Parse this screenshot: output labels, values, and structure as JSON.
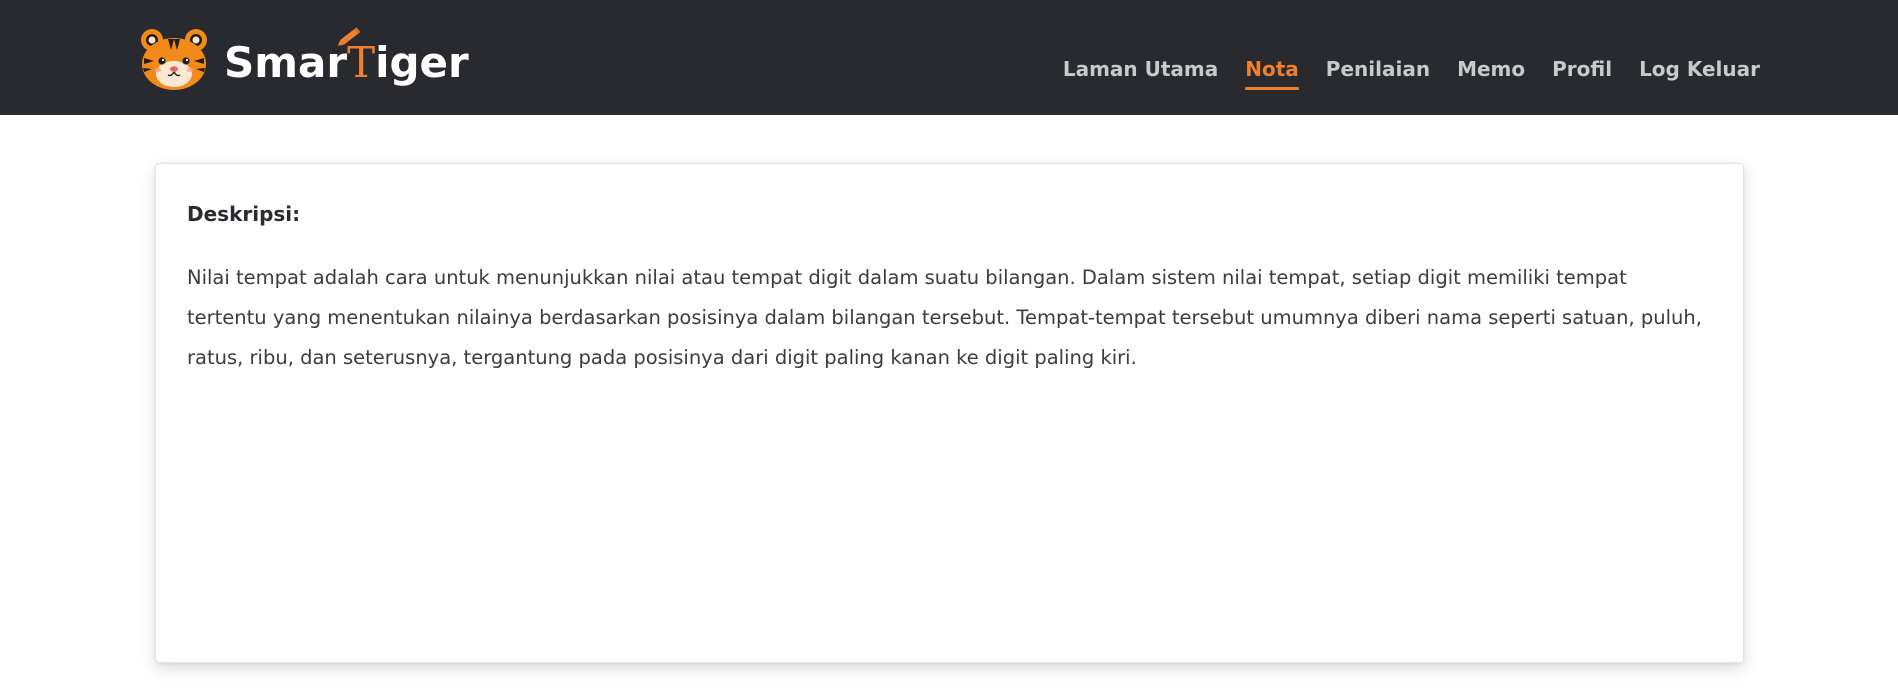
{
  "brand": {
    "name_part1": "Smar",
    "name_accent": "T",
    "name_part2": "iger",
    "logo_icon": "tiger-icon",
    "pencil_icon": "pencil-icon",
    "accent_color": "#f07f2d"
  },
  "nav": {
    "items": [
      {
        "label": "Laman Utama",
        "active": false
      },
      {
        "label": "Nota",
        "active": true
      },
      {
        "label": "Penilaian",
        "active": false
      },
      {
        "label": "Memo",
        "active": false
      },
      {
        "label": "Profil",
        "active": false
      },
      {
        "label": "Log Keluar",
        "active": false
      }
    ]
  },
  "content": {
    "label": "Deskripsi:",
    "text": "Nilai tempat adalah cara untuk menunjukkan nilai atau tempat digit dalam suatu bilangan. Dalam sistem nilai tempat, setiap digit memiliki tempat tertentu yang menentukan nilainya berdasarkan posisinya dalam bilangan tersebut. Tempat-tempat tersebut umumnya diberi nama seperti satuan, puluh, ratus, ribu, dan seterusnya, tergantung pada posisinya dari digit paling kanan ke digit paling kiri."
  },
  "colors": {
    "header_bg": "#282a30",
    "nav_text": "#c8c9cc",
    "accent": "#f07f2d"
  }
}
